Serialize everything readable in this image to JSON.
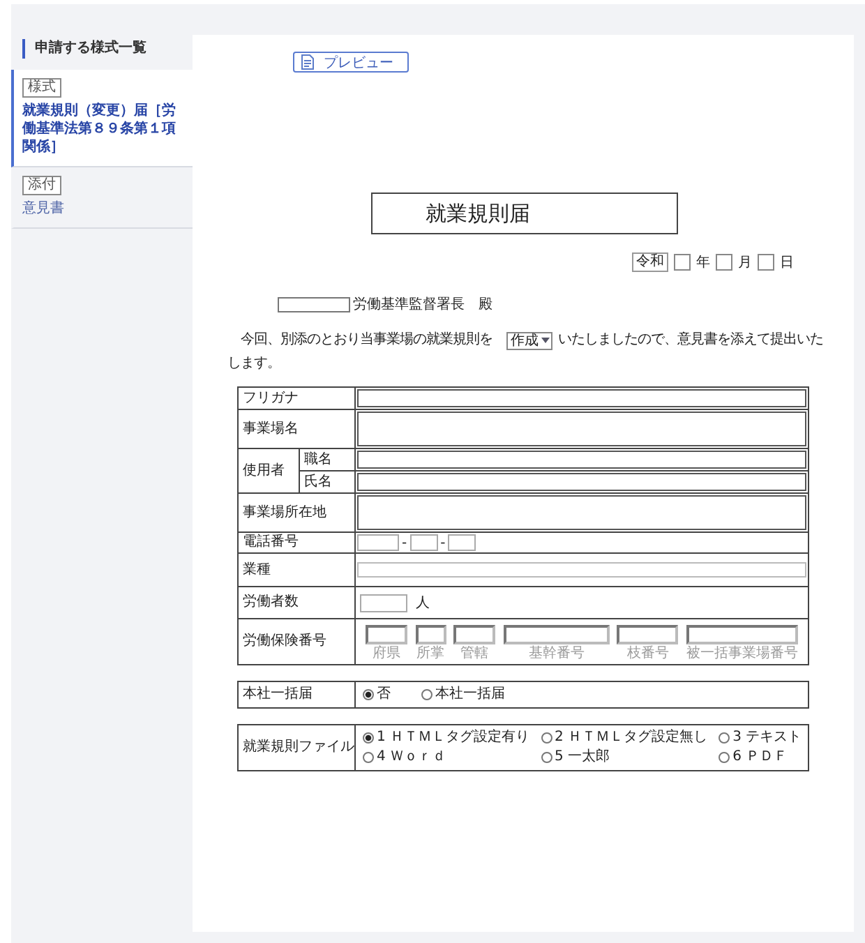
{
  "sidebar": {
    "heading": "申請する様式一覧",
    "items": [
      {
        "tag": "様式",
        "label": "就業規則（変更）届［労働基準法第８９条第１項関係］",
        "selected": true
      },
      {
        "tag": "添付",
        "label": "意見書",
        "selected": false
      }
    ]
  },
  "toolbar": {
    "preview_button": "プレビュー"
  },
  "document": {
    "title": "就業規則届",
    "date": {
      "era": "令和",
      "units": [
        "年",
        "月",
        "日"
      ]
    },
    "addressee": {
      "suffix": "労働基準監督署長　殿"
    },
    "statement": {
      "before": "　今回、別添のとおり当事業場の就業規則を",
      "action": "作成",
      "after": "いたしましたので、意見書を添えて提出いた",
      "continuation": "します。"
    },
    "details": {
      "rows": [
        {
          "kind": "line",
          "label": "フリガナ"
        },
        {
          "kind": "area",
          "label": "事業場名"
        },
        {
          "kind": "group",
          "label": "使用者",
          "sub_rows": [
            {
              "label": "職名"
            },
            {
              "label": "氏名"
            }
          ]
        },
        {
          "kind": "area",
          "label": "事業場所在地"
        },
        {
          "kind": "phone",
          "label": "電話番号",
          "separator": "-"
        },
        {
          "kind": "wide",
          "label": "業種"
        },
        {
          "kind": "count",
          "label": "労働者数",
          "unit": "人"
        },
        {
          "kind": "codes",
          "label": "労働保険番号",
          "parts": [
            "府県",
            "所掌",
            "管轄",
            "基幹番号",
            "枝番号",
            "被一括事業場番号"
          ]
        }
      ]
    },
    "choices": [
      {
        "kind": "inline",
        "label": "本社一括届",
        "options": [
          {
            "label": "否",
            "selected": true
          },
          {
            "label": "本社一括届",
            "selected": false
          }
        ]
      },
      {
        "kind": "grid",
        "label": "就業規則ファイル",
        "options": [
          {
            "label": "1 ＨＴＭＬタグ設定有り",
            "selected": true
          },
          {
            "label": "2 ＨＴＭＬタグ設定無し",
            "selected": false
          },
          {
            "label": "3 テキスト",
            "selected": false
          },
          {
            "label": "4 Ｗｏｒｄ",
            "selected": false
          },
          {
            "label": "5 一太郎",
            "selected": false
          },
          {
            "label": "6 ＰＤＦ",
            "selected": false
          }
        ]
      }
    ]
  }
}
